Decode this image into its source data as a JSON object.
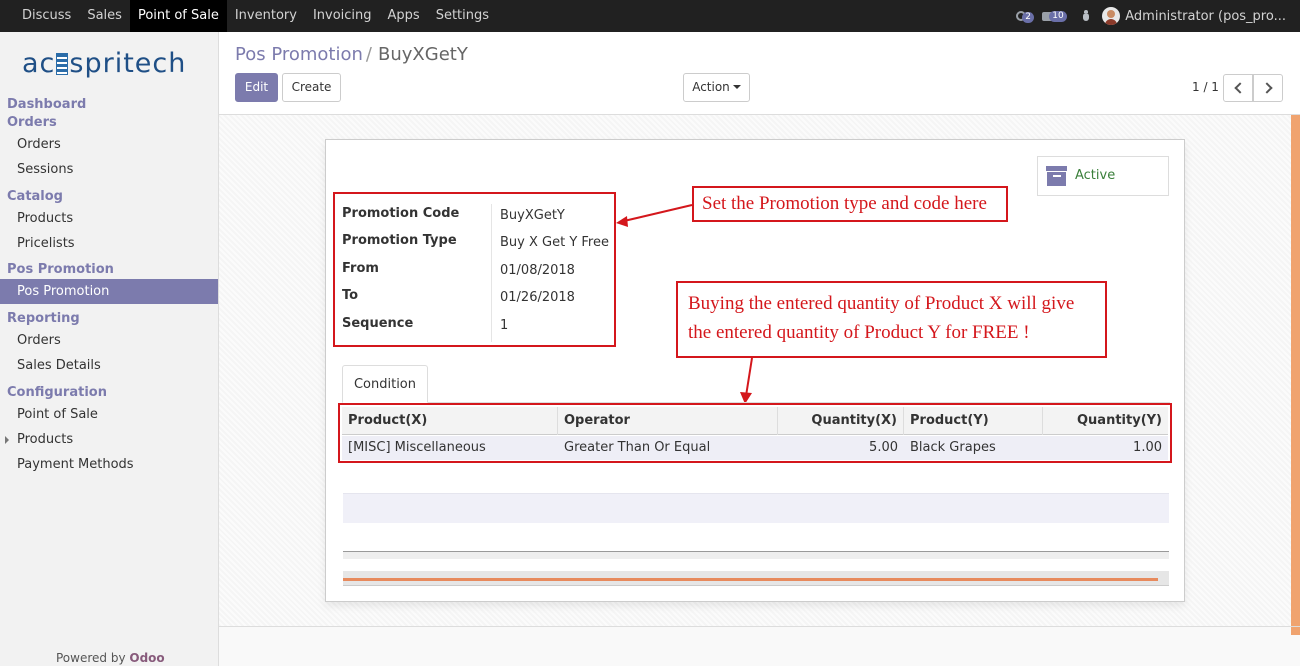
{
  "topbar": {
    "menu": [
      "Discuss",
      "Sales",
      "Point of Sale",
      "Inventory",
      "Invoicing",
      "Apps",
      "Settings"
    ],
    "active_menu": "Point of Sale",
    "chat_badge": "2",
    "message_badge": "10",
    "user": "Administrator (pos_pro..."
  },
  "sidebar": {
    "logo_left": "ac",
    "logo_right": "spritech",
    "sections": [
      {
        "header": "Dashboard",
        "items": []
      },
      {
        "header": "Orders",
        "items": [
          "Orders",
          "Sessions"
        ]
      },
      {
        "header": "Catalog",
        "items": [
          "Products",
          "Pricelists"
        ]
      },
      {
        "header": "Pos Promotion",
        "items": [
          "Pos Promotion"
        ]
      },
      {
        "header": "Reporting",
        "items": [
          "Orders",
          "Sales Details"
        ]
      },
      {
        "header": "Configuration",
        "items": [
          "Point of Sale",
          "Products",
          "Payment Methods"
        ]
      }
    ],
    "active_item": "Pos Promotion",
    "powered_prefix": "Powered by",
    "powered_brand": "Odoo"
  },
  "breadcrumb": {
    "parent": "Pos Promotion",
    "separator": "/",
    "current": "BuyXGetY"
  },
  "buttons": {
    "edit": "Edit",
    "create": "Create",
    "action": "Action"
  },
  "pager": {
    "text": "1 / 1"
  },
  "record": {
    "active_label": "Active",
    "fields": [
      {
        "label": "Promotion Code",
        "value": "BuyXGetY"
      },
      {
        "label": "Promotion Type",
        "value": "Buy X Get Y Free"
      },
      {
        "label": "From",
        "value": "01/08/2018"
      },
      {
        "label": "To",
        "value": "01/26/2018"
      },
      {
        "label": "Sequence",
        "value": "1"
      }
    ],
    "tab": "Condition",
    "table": {
      "headers": [
        "Product(X)",
        "Operator",
        "Quantity(X)",
        "Product(Y)",
        "Quantity(Y)"
      ],
      "rows": [
        [
          "[MISC] Miscellaneous",
          "Greater Than Or Equal",
          "5.00",
          "Black Grapes",
          "1.00"
        ]
      ]
    }
  },
  "annotations": {
    "callout1": "Set the Promotion type and code here",
    "callout2_line1": "Buying the entered quantity of Product X will give",
    "callout2_line2": "the entered quantity of Product Y for FREE !"
  },
  "colors": {
    "brand": "#7c7bad",
    "annotation": "#d4171c",
    "topbar": "#212121"
  }
}
